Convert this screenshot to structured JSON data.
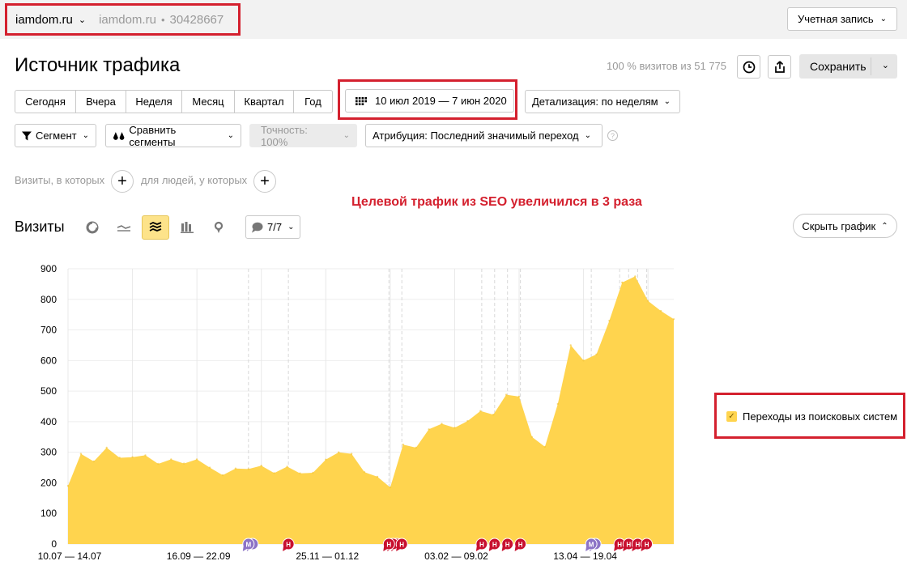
{
  "top_bar": {
    "site_name": "iamdom.ru",
    "counter_site": "iamdom.ru",
    "counter_separator": "•",
    "counter_id": "30428667",
    "account_label": "Учетная запись"
  },
  "header": {
    "title": "Источник трафика",
    "visits_info": "100 % визитов из 51 775",
    "save_label": "Сохранить"
  },
  "periods": [
    "Сегодня",
    "Вчера",
    "Неделя",
    "Месяц",
    "Квартал",
    "Год"
  ],
  "date_range": "10 июл 2019 — 7 июн 2020",
  "detail": "Детализация: по неделям",
  "filters": {
    "segment": "Сегмент",
    "compare": "Сравнить сегменты",
    "accuracy": "Точность: 100%",
    "attribution": "Атрибуция: Последний значимый переход",
    "help": "?"
  },
  "conditions": {
    "visits_label": "Визиты, в которых",
    "people_label": "для людей, у которых"
  },
  "annotation": "Целевой трафик из SEO увеличился в 3 раза",
  "chart_header": {
    "title": "Визиты",
    "segment_count": "7/7",
    "hide_label": "Скрыть график"
  },
  "legend": {
    "label": "Переходы из поисковых систем",
    "color": "#ffd44e"
  },
  "chart_data": {
    "type": "area",
    "title": "Визиты",
    "ylim": [
      0,
      900
    ],
    "yticks": [
      0,
      100,
      200,
      300,
      400,
      500,
      600,
      700,
      800,
      900
    ],
    "xtick_labels": [
      "10.07 — 14.07",
      "16.09 — 22.09",
      "25.11 — 01.12",
      "03.02 — 09.02",
      "13.04 — 19.04"
    ],
    "xtick_index": [
      0,
      10,
      20,
      30,
      40
    ],
    "grid": true,
    "legend_position": "right",
    "series": [
      {
        "name": "Переходы из поисковых систем",
        "color": "#ffd44e",
        "values": [
          190,
          295,
          270,
          315,
          282,
          284,
          290,
          262,
          277,
          263,
          277,
          250,
          225,
          247,
          245,
          256,
          232,
          253,
          231,
          233,
          276,
          300,
          295,
          235,
          220,
          185,
          325,
          315,
          375,
          393,
          380,
          402,
          435,
          423,
          488,
          482,
          350,
          318,
          458,
          650,
          600,
          620,
          730,
          855,
          875,
          795,
          762,
          735
        ]
      }
    ],
    "event_markers": [
      {
        "letter": "M",
        "count": 2,
        "index": 14.0,
        "color": "#8c73c6"
      },
      {
        "letter": "H",
        "count": 1,
        "index": 17.1,
        "color": "#c8102e"
      },
      {
        "letter": "H",
        "count": 3,
        "index": 24.9,
        "color": "#c8102e"
      },
      {
        "letter": "H",
        "count": 1,
        "index": 25.9,
        "color": "#c8102e"
      },
      {
        "letter": "H",
        "count": 1,
        "index": 32.1,
        "color": "#c8102e"
      },
      {
        "letter": "H",
        "count": 1,
        "index": 33.1,
        "color": "#c8102e"
      },
      {
        "letter": "H",
        "count": 1,
        "index": 34.1,
        "color": "#c8102e"
      },
      {
        "letter": "H",
        "count": 1,
        "index": 35.1,
        "color": "#c8102e"
      },
      {
        "letter": "M",
        "count": 2,
        "index": 40.6,
        "color": "#8c73c6"
      },
      {
        "letter": "H",
        "count": 1,
        "index": 42.8,
        "color": "#c8102e"
      },
      {
        "letter": "H",
        "count": 1,
        "index": 43.5,
        "color": "#c8102e"
      },
      {
        "letter": "H",
        "count": 1,
        "index": 44.2,
        "color": "#c8102e"
      },
      {
        "letter": "H",
        "count": 1,
        "index": 44.9,
        "color": "#c8102e"
      }
    ]
  }
}
